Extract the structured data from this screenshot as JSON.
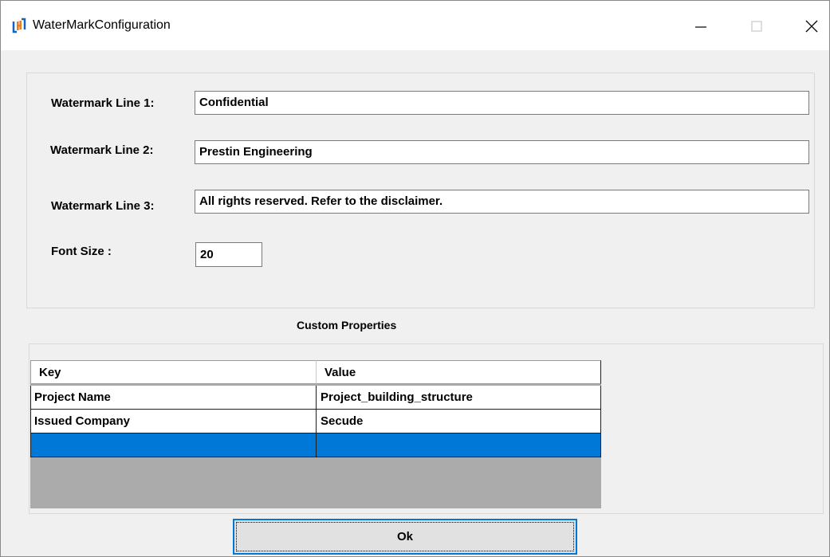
{
  "window": {
    "title": "WaterMarkConfiguration",
    "icon": "app-logo-icon",
    "controls": [
      "minimize-icon",
      "maximize-icon",
      "close-icon"
    ]
  },
  "form": {
    "line1": {
      "label": "Watermark Line 1:",
      "value": "Confidential"
    },
    "line2": {
      "label": "Watermark Line 2:",
      "value": "Prestin Engineering"
    },
    "line3": {
      "label": "Watermark Line 3:",
      "value": "All rights reserved. Refer to the disclaimer."
    },
    "font_size": {
      "label": "Font Size :",
      "value": "20"
    }
  },
  "custom_properties": {
    "title": "Custom Properties",
    "columns": [
      "Key",
      "Value"
    ],
    "rows": [
      [
        "Project Name",
        "Project_building_structure"
      ],
      [
        "Issued Company",
        "Secude"
      ],
      [
        "",
        ""
      ]
    ]
  },
  "ok_button": {
    "label": "Ok"
  },
  "colors": {
    "selection": "#0078d7",
    "background": "#f0f0f0",
    "grid_empty": "#ababab"
  }
}
